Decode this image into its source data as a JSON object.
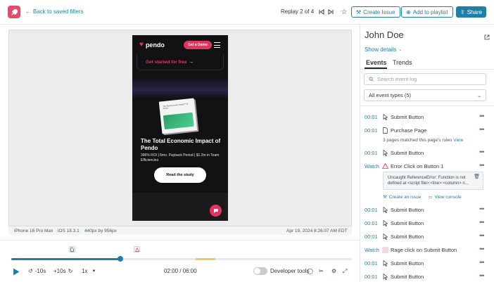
{
  "header": {
    "back_label": "Back to saved filters",
    "replay_label": "Replay 2 of 4",
    "create_issue_label": "Create Issue",
    "add_playlist_label": "Add to playlist",
    "share_label": "Share"
  },
  "phone": {
    "brand": "pendo",
    "demo_button": "Get a Demo",
    "cta": "Get started for free",
    "book_text": "The Total Economic Impact™ Of Pendo",
    "headline": "The Total Economic Impact of Pendo",
    "subline": "396% ROI | 6mo. Payback Period | $1.2m in Team Efficiencies",
    "study_button": "Read the study"
  },
  "device": {
    "model": "iPhone 16 Pro Max",
    "os": "iOS 18.3.1",
    "resolution": "440px by 956px",
    "timestamp": "Apr 19, 2024 8:26:07 AM EDT"
  },
  "controls": {
    "back10": "-10s",
    "fwd10": "+10s",
    "speed": "1x",
    "time": "02:00 / 06:00",
    "dev_tools": "Developer tools",
    "progress": 0.32
  },
  "sidebar": {
    "user_name": "John Doe",
    "show_details": "Show details",
    "tabs": [
      "Events",
      "Trends"
    ],
    "search_placeholder": "Search event log",
    "filter_value": "All event types (5)",
    "events": [
      {
        "time": "00:01",
        "label": "Submit Button",
        "icon": "cursor-icon"
      },
      {
        "time": "00:01",
        "label": "Purchase Page",
        "icon": "page-icon"
      },
      {
        "time": "00:01",
        "label": "Submit Button",
        "icon": "cursor-icon"
      },
      {
        "time": "Watch",
        "label": "Error Click on Button 1",
        "icon": "warning-icon"
      },
      {
        "time": "00:01",
        "label": "Submit Button",
        "icon": "cursor-icon"
      },
      {
        "time": "00:01",
        "label": "Submit Button",
        "icon": "cursor-icon"
      },
      {
        "time": "00:01",
        "label": "Submit Button",
        "icon": "cursor-icon"
      },
      {
        "time": "Watch",
        "label": "Rage click on Submit Button",
        "icon": "rage-icon"
      },
      {
        "time": "00:01",
        "label": "Submit Button",
        "icon": "cursor-icon"
      },
      {
        "time": "00:01",
        "label": "Submit Button",
        "icon": "cursor-icon"
      }
    ],
    "page_note_prefix": "3 pages matched this page's rules",
    "page_note_link": "View",
    "error_text": "Uncaught ReferenceError: Function is not defined at <script file>:<line>:<column> n...",
    "create_issue_link": "Create an issue",
    "view_console_link": "View console"
  },
  "colors": {
    "accent": "#1f7fa6",
    "brand": "#e54a6b",
    "warning": "#f5c56a"
  }
}
